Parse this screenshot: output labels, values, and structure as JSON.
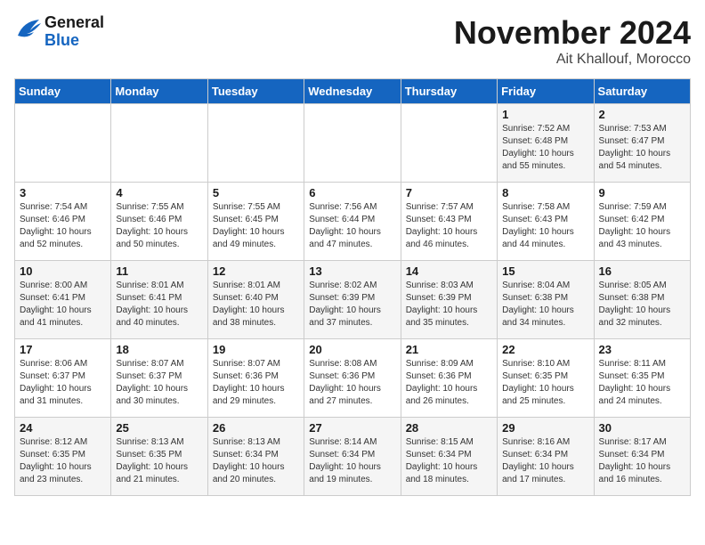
{
  "header": {
    "logo_line1": "General",
    "logo_line2": "Blue",
    "month": "November 2024",
    "location": "Ait Khallouf, Morocco"
  },
  "weekdays": [
    "Sunday",
    "Monday",
    "Tuesday",
    "Wednesday",
    "Thursday",
    "Friday",
    "Saturday"
  ],
  "weeks": [
    [
      {
        "day": "",
        "info": ""
      },
      {
        "day": "",
        "info": ""
      },
      {
        "day": "",
        "info": ""
      },
      {
        "day": "",
        "info": ""
      },
      {
        "day": "",
        "info": ""
      },
      {
        "day": "1",
        "info": "Sunrise: 7:52 AM\nSunset: 6:48 PM\nDaylight: 10 hours and 55 minutes."
      },
      {
        "day": "2",
        "info": "Sunrise: 7:53 AM\nSunset: 6:47 PM\nDaylight: 10 hours and 54 minutes."
      }
    ],
    [
      {
        "day": "3",
        "info": "Sunrise: 7:54 AM\nSunset: 6:46 PM\nDaylight: 10 hours and 52 minutes."
      },
      {
        "day": "4",
        "info": "Sunrise: 7:55 AM\nSunset: 6:46 PM\nDaylight: 10 hours and 50 minutes."
      },
      {
        "day": "5",
        "info": "Sunrise: 7:55 AM\nSunset: 6:45 PM\nDaylight: 10 hours and 49 minutes."
      },
      {
        "day": "6",
        "info": "Sunrise: 7:56 AM\nSunset: 6:44 PM\nDaylight: 10 hours and 47 minutes."
      },
      {
        "day": "7",
        "info": "Sunrise: 7:57 AM\nSunset: 6:43 PM\nDaylight: 10 hours and 46 minutes."
      },
      {
        "day": "8",
        "info": "Sunrise: 7:58 AM\nSunset: 6:43 PM\nDaylight: 10 hours and 44 minutes."
      },
      {
        "day": "9",
        "info": "Sunrise: 7:59 AM\nSunset: 6:42 PM\nDaylight: 10 hours and 43 minutes."
      }
    ],
    [
      {
        "day": "10",
        "info": "Sunrise: 8:00 AM\nSunset: 6:41 PM\nDaylight: 10 hours and 41 minutes."
      },
      {
        "day": "11",
        "info": "Sunrise: 8:01 AM\nSunset: 6:41 PM\nDaylight: 10 hours and 40 minutes."
      },
      {
        "day": "12",
        "info": "Sunrise: 8:01 AM\nSunset: 6:40 PM\nDaylight: 10 hours and 38 minutes."
      },
      {
        "day": "13",
        "info": "Sunrise: 8:02 AM\nSunset: 6:39 PM\nDaylight: 10 hours and 37 minutes."
      },
      {
        "day": "14",
        "info": "Sunrise: 8:03 AM\nSunset: 6:39 PM\nDaylight: 10 hours and 35 minutes."
      },
      {
        "day": "15",
        "info": "Sunrise: 8:04 AM\nSunset: 6:38 PM\nDaylight: 10 hours and 34 minutes."
      },
      {
        "day": "16",
        "info": "Sunrise: 8:05 AM\nSunset: 6:38 PM\nDaylight: 10 hours and 32 minutes."
      }
    ],
    [
      {
        "day": "17",
        "info": "Sunrise: 8:06 AM\nSunset: 6:37 PM\nDaylight: 10 hours and 31 minutes."
      },
      {
        "day": "18",
        "info": "Sunrise: 8:07 AM\nSunset: 6:37 PM\nDaylight: 10 hours and 30 minutes."
      },
      {
        "day": "19",
        "info": "Sunrise: 8:07 AM\nSunset: 6:36 PM\nDaylight: 10 hours and 29 minutes."
      },
      {
        "day": "20",
        "info": "Sunrise: 8:08 AM\nSunset: 6:36 PM\nDaylight: 10 hours and 27 minutes."
      },
      {
        "day": "21",
        "info": "Sunrise: 8:09 AM\nSunset: 6:36 PM\nDaylight: 10 hours and 26 minutes."
      },
      {
        "day": "22",
        "info": "Sunrise: 8:10 AM\nSunset: 6:35 PM\nDaylight: 10 hours and 25 minutes."
      },
      {
        "day": "23",
        "info": "Sunrise: 8:11 AM\nSunset: 6:35 PM\nDaylight: 10 hours and 24 minutes."
      }
    ],
    [
      {
        "day": "24",
        "info": "Sunrise: 8:12 AM\nSunset: 6:35 PM\nDaylight: 10 hours and 23 minutes."
      },
      {
        "day": "25",
        "info": "Sunrise: 8:13 AM\nSunset: 6:35 PM\nDaylight: 10 hours and 21 minutes."
      },
      {
        "day": "26",
        "info": "Sunrise: 8:13 AM\nSunset: 6:34 PM\nDaylight: 10 hours and 20 minutes."
      },
      {
        "day": "27",
        "info": "Sunrise: 8:14 AM\nSunset: 6:34 PM\nDaylight: 10 hours and 19 minutes."
      },
      {
        "day": "28",
        "info": "Sunrise: 8:15 AM\nSunset: 6:34 PM\nDaylight: 10 hours and 18 minutes."
      },
      {
        "day": "29",
        "info": "Sunrise: 8:16 AM\nSunset: 6:34 PM\nDaylight: 10 hours and 17 minutes."
      },
      {
        "day": "30",
        "info": "Sunrise: 8:17 AM\nSunset: 6:34 PM\nDaylight: 10 hours and 16 minutes."
      }
    ]
  ]
}
